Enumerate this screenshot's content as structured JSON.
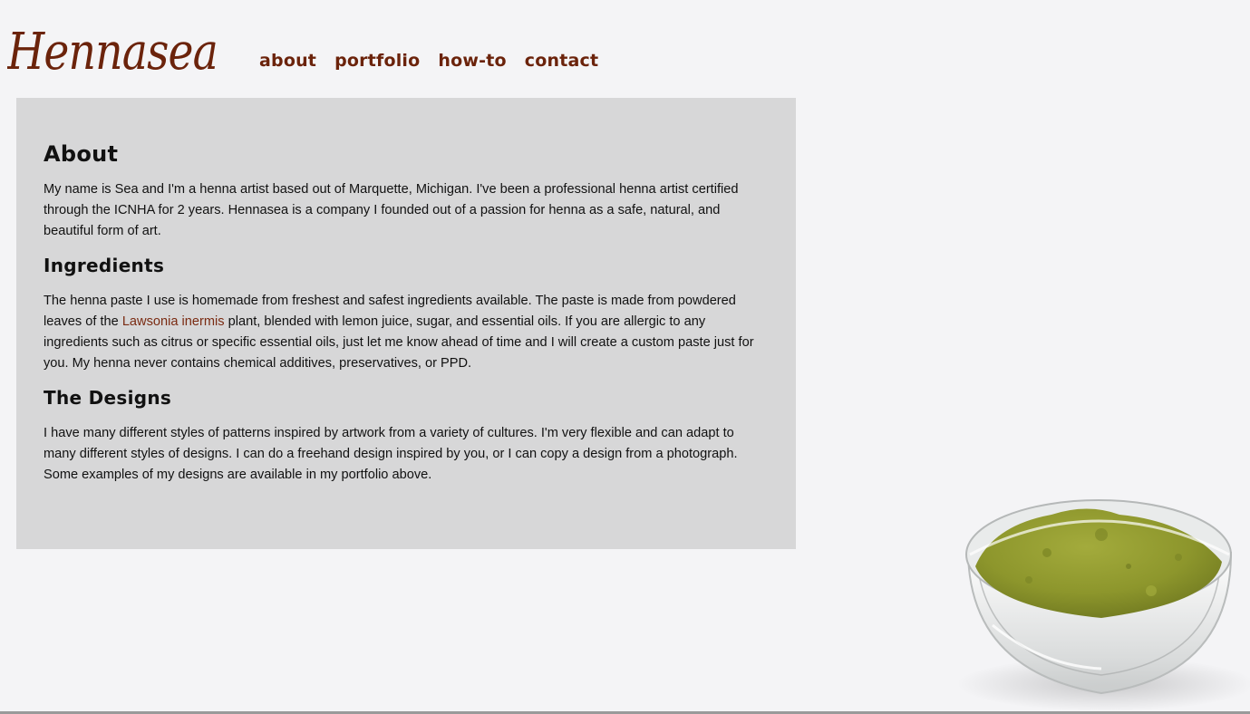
{
  "brand": {
    "logo_text": "Hennasea"
  },
  "nav": {
    "items": [
      {
        "label": "about"
      },
      {
        "label": "portfolio"
      },
      {
        "label": "how-to"
      },
      {
        "label": "contact"
      }
    ]
  },
  "content": {
    "about": {
      "heading": "About",
      "text": "My name is Sea and I'm a henna artist based out of Marquette, Michigan. I've been a professional henna artist certified through the ICNHA for 2 years. Hennasea is a company I founded out of a passion for henna as a safe, natural, and beautiful form of art."
    },
    "ingredients": {
      "heading": "Ingredients",
      "text_before": "The henna paste I use is homemade from freshest and safest ingredients available. The paste is made from powdered leaves of the ",
      "link": "Lawsonia inermis",
      "text_after": " plant, blended with lemon juice, sugar, and essential oils. If you are allergic to any ingredients such as citrus or specific essential oils, just let me know ahead of time and I will create a custom paste just for you. My henna never contains chemical additives, preservatives, or PPD."
    },
    "designs": {
      "heading": "The Designs",
      "text": "I have many different styles of patterns inspired by artwork from a variety of cultures. I'm very flexible and can adapt to many different styles of designs. I can do a freehand design inspired by you, or I can copy a design from a photograph. Some examples of my designs are available in my portfolio above."
    }
  },
  "colors": {
    "accent": "#6b230b",
    "panel": "#d7d7d8",
    "background": "#f4f4f6",
    "henna_powder": "#8f9a2e"
  },
  "image": {
    "subject": "henna-powder-bowl"
  }
}
